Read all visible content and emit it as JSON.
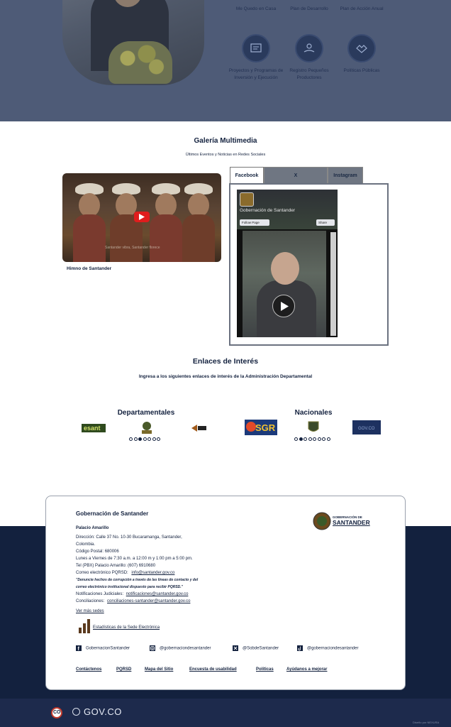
{
  "top": {
    "tiles": [
      {
        "label": "Me Quedo en Casa"
      },
      {
        "label": "Plan de Desarrollo"
      },
      {
        "label": "Plan de Acción Anual"
      },
      {
        "label": "Proyectos y Programas de Inversión y Ejecución"
      },
      {
        "label": "Registro Pequeños Productores"
      },
      {
        "label": "Políticas Públicas"
      }
    ]
  },
  "gallery": {
    "title": "Galería Multimedia",
    "subtitle": "Últimos Eventos y Noticias en Redes Sociales",
    "video_label": "Himno de Santander",
    "video_caption": "Santander vibra, Santander florece",
    "tabs": [
      "Facebook",
      "X",
      "Instagram"
    ],
    "fb_page_name": "Gobernación de Santander",
    "fb_follow": "Follow Page",
    "fb_share": "Share"
  },
  "links": {
    "title": "Enlaces de Interés",
    "subtitle": "Ingresa a los siguientes enlaces de interés de la Administración Departamental",
    "departamentales": {
      "title": "Departamentales",
      "logos": [
        "esant",
        "idesan",
        "logo"
      ],
      "dots": 7,
      "active": 2
    },
    "nacionales": {
      "title": "Nacionales",
      "logos": [
        "SGR",
        "escudo",
        "GOV.CO"
      ],
      "dots": 8,
      "active": 1
    }
  },
  "footer": {
    "org": "Gobernación de Santander",
    "logo_text_1": "GOBERNACIÓN DE",
    "logo_text_2": "SANTANDER",
    "palace": "Palacio Amarillo",
    "address_1": "Dirección: Calle 37 No. 10-30 Bucaramanga, Santander,",
    "address_2": "Colombia.",
    "postal": "Código Postal: 680006",
    "hours": "Lunes a Viernes de 7:30 a.m. a 12:00 m y 1:00 pm a 5:00 pm.",
    "phone": "Tel (PBX) Palacio Amarillo: (607) 6910680",
    "email_label": "Correo electrónico PQRSD:",
    "email": "info@santander.gov.co",
    "notice_1": "\"Denuncie hechos de corrupción a través de las líneas de contacto y del",
    "notice_2": "correo electrónico institucional dispuesto para recibir PQRSD.\"",
    "notif_label": "Notificaciones Judiciales:",
    "notif_email": "notificaciones@santander.gov.co",
    "concil_label": "Conciliaciones:",
    "concil_email": "conciliaciones-santander@santander.gov.co",
    "more_sites": "Ver más sedes",
    "stats": "Estadísticas de la Sede Electrónica",
    "social": [
      "GobernacionSantander",
      "@gobernaciondesantander",
      "@SobdeSantander",
      "@gobernaciondesantander"
    ],
    "bottom_links": [
      "Contáctenos",
      "PQRSD",
      "Mapa del Sitio",
      "Encuesta de usabilidad",
      "Políticas",
      "Ayúdanos a mejorar"
    ]
  },
  "bottom_bar": {
    "govco": "GOV.CO",
    "co": "CO",
    "credit": "Diseño por NEXURA"
  }
}
